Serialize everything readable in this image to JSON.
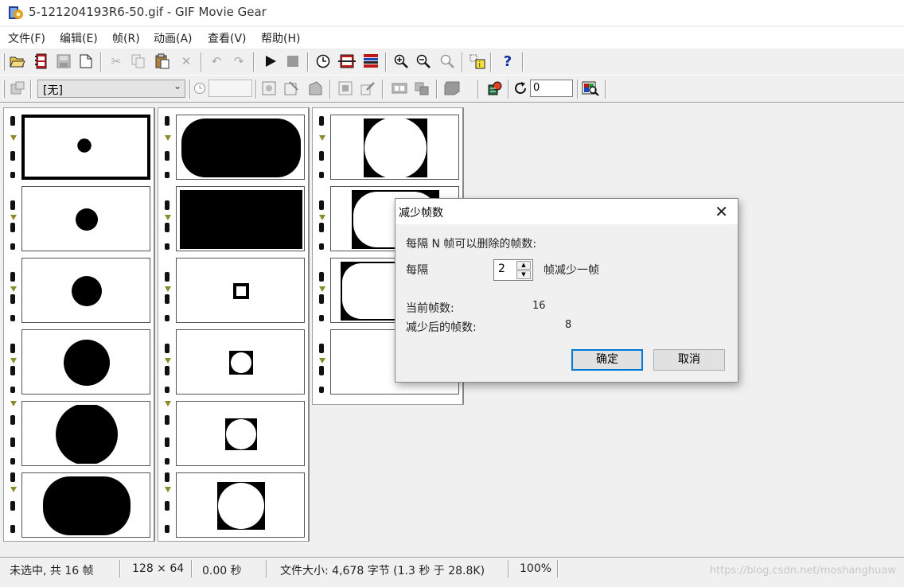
{
  "window": {
    "title": "5-121204193R6-50.gif - GIF Movie Gear"
  },
  "menu": [
    "文件(F)",
    "编辑(E)",
    "帧(R)",
    "动画(A)",
    "查看(V)",
    "帮助(H)"
  ],
  "toolbar2": {
    "combo_value": "[无]",
    "loop_count": "0"
  },
  "icons": {
    "toolbar1": [
      "open-icon",
      "open-frames-icon",
      "save-icon",
      "new-icon",
      "cut-icon",
      "copy-icon",
      "paste-icon",
      "delete-icon",
      "undo-icon",
      "redo-icon",
      "play-icon",
      "stop-icon",
      "timing-icon",
      "reduce-frames-icon",
      "palette-icon",
      "zoom-in-icon",
      "zoom-out-icon",
      "zoom-fit-icon",
      "frame-info-icon",
      "help-icon"
    ],
    "toolbar2": [
      "properties-icon",
      "palette-combo",
      "delay-icon",
      "crop-icon",
      "resize-icon",
      "rotate-icon",
      "transparency-icon",
      "edit-icon",
      "frame-props-icon",
      "flip-icon",
      "optimize-icon",
      "loop-icon",
      "preview-icon"
    ]
  },
  "frames": {
    "total": 16,
    "columns": 3
  },
  "statusbar": {
    "selection": "未选中, 共 16 帧",
    "dimensions": "128 × 64",
    "duration": "0.00 秒",
    "filesize": "文件大小: 4,678 字节  (1.3 秒 于 28.8K)",
    "zoom": "100%",
    "watermark": "https://blog.csdn.net/moshanghuaw"
  },
  "dialog": {
    "title": "减少帧数",
    "description": "每隔 N 帧可以删除的帧数:",
    "every_label": "每隔",
    "every_value": "2",
    "every_suffix": "帧减少一帧",
    "current_label": "当前帧数:",
    "current_value": "16",
    "after_label": "减少后的帧数:",
    "after_value": "8",
    "ok_label": "确定",
    "cancel_label": "取消"
  }
}
